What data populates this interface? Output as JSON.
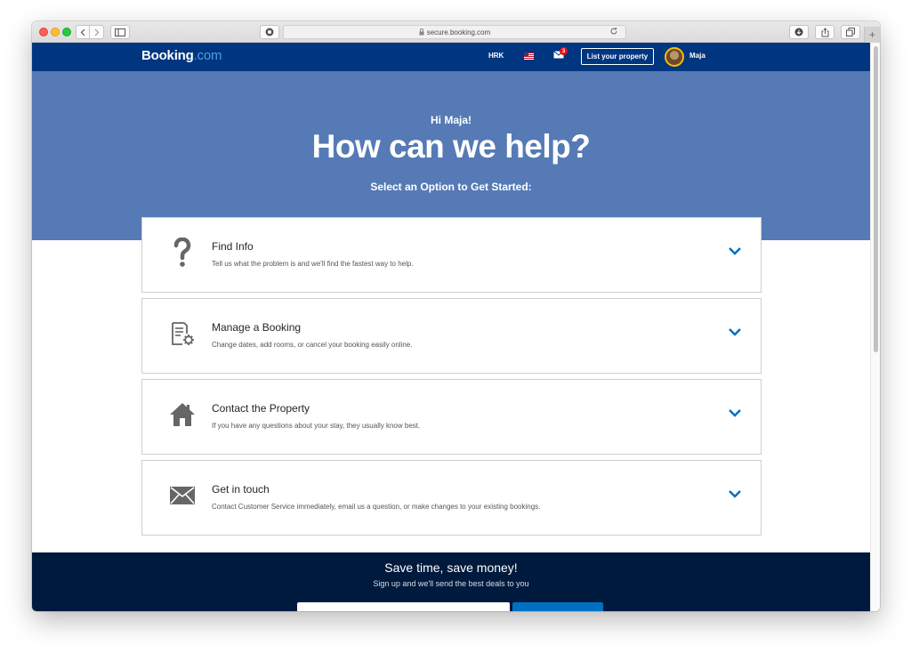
{
  "browser": {
    "url": "secure.booking.com",
    "new_tab_glyph": "+"
  },
  "header": {
    "logo_main": "Booking",
    "logo_suffix": ".com",
    "currency": "HRK",
    "language_flag": "us-flag",
    "notification_count": "3",
    "list_property_label": "List your property",
    "user_name": "Maja"
  },
  "hero": {
    "greeting": "Hi Maja!",
    "title": "How can we help?",
    "subtitle": "Select an Option to Get Started:"
  },
  "options": [
    {
      "icon": "question-mark-icon",
      "title": "Find Info",
      "description": "Tell us what the problem is and we'll find the fastest way to help."
    },
    {
      "icon": "booking-settings-icon",
      "title": "Manage a Booking",
      "description": "Change dates, add rooms, or cancel your booking easily online."
    },
    {
      "icon": "house-icon",
      "title": "Contact the Property",
      "description": "If you have any questions about your stay, they usually know best."
    },
    {
      "icon": "envelope-icon",
      "title": "Get in touch",
      "description": "Contact Customer Service immediately, email us a question, or make changes to your existing bookings."
    }
  ],
  "footer": {
    "title": "Save time, save money!",
    "subtitle": "Sign up and we'll send the best deals to you"
  },
  "colors": {
    "brand_dark": "#003580",
    "hero_blue": "#557ab5",
    "accent_blue": "#0071c2",
    "footer_navy": "#001a3d"
  }
}
